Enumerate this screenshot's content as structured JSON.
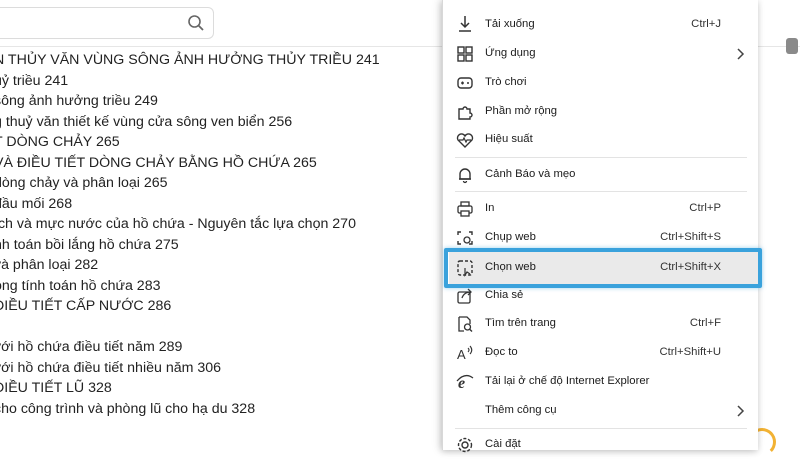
{
  "document": {
    "toc_lines": [
      "N THỦY VĂN VÙNG SÔNG ẢNH HƯỞNG THỦY TRIỀU 241",
      "uỷ triều 241",
      "sông ảnh hưởng triều 249",
      "g thuỷ văn thiết kế vùng cửa sông ven biển 256",
      "T DÒNG CHẢY 265",
      "VÀ ĐIỀU TIẾT DÒNG CHẢY BẰNG HỒ CHỨA 265",
      "dòng chảy và phân loại 265",
      "đầu mối 268",
      "ích và mực nước của hồ chứa - Nguyên tắc lựa chọn 270",
      "nh toán bồi lắng hồ chứa 275",
      "và phân loại 282",
      "ong tính toán hồ chứa 283",
      " ĐIỀU TIẾT CẤP NƯỚC 286",
      "",
      "với hồ chứa điều tiết năm 289",
      "với hồ chứa điều tiết nhiều năm 306",
      "ĐIỀU TIẾT LŨ 328",
      "cho công trình và phòng lũ cho hạ du 328"
    ],
    "search_icon": "search-icon"
  },
  "menu": {
    "items": [
      {
        "label": "Tải xuống",
        "shortcut": "Ctrl+J",
        "icon": "download-icon"
      },
      {
        "label": "Ứng dụng",
        "shortcut": "",
        "icon": "apps-icon",
        "chevron": true
      },
      {
        "label": "Trò chơi",
        "shortcut": "",
        "icon": "games-icon"
      },
      {
        "label": "Phần mở rộng",
        "shortcut": "",
        "icon": "extensions-icon"
      },
      {
        "label": "Hiệu suất",
        "shortcut": "",
        "icon": "performance-icon"
      },
      {
        "label": "Cảnh Báo và mẹo",
        "shortcut": "",
        "icon": "bell-icon"
      },
      {
        "label": "In",
        "shortcut": "Ctrl+P",
        "icon": "print-icon"
      },
      {
        "label": "Chụp web",
        "shortcut": "Ctrl+Shift+S",
        "icon": "web-capture-icon"
      },
      {
        "label": "Chọn web",
        "shortcut": "Ctrl+Shift+X",
        "icon": "web-select-icon"
      },
      {
        "label": "Chia sẻ",
        "shortcut": "",
        "icon": "share-icon"
      },
      {
        "label": "Tìm trên trang",
        "shortcut": "Ctrl+F",
        "icon": "find-icon"
      },
      {
        "label": "Đọc to",
        "shortcut": "Ctrl+Shift+U",
        "icon": "read-aloud-icon"
      },
      {
        "label": "Tải lại ở chế độ Internet Explorer",
        "shortcut": "",
        "icon": "ie-icon"
      },
      {
        "label": "Thêm công cụ",
        "shortcut": "",
        "icon": "",
        "chevron": true
      },
      {
        "label": "Cài đặt",
        "shortcut": "",
        "icon": "settings-icon"
      }
    ],
    "highlighted_item": "Chọn web",
    "highlight_color": "#3aa2dc"
  }
}
